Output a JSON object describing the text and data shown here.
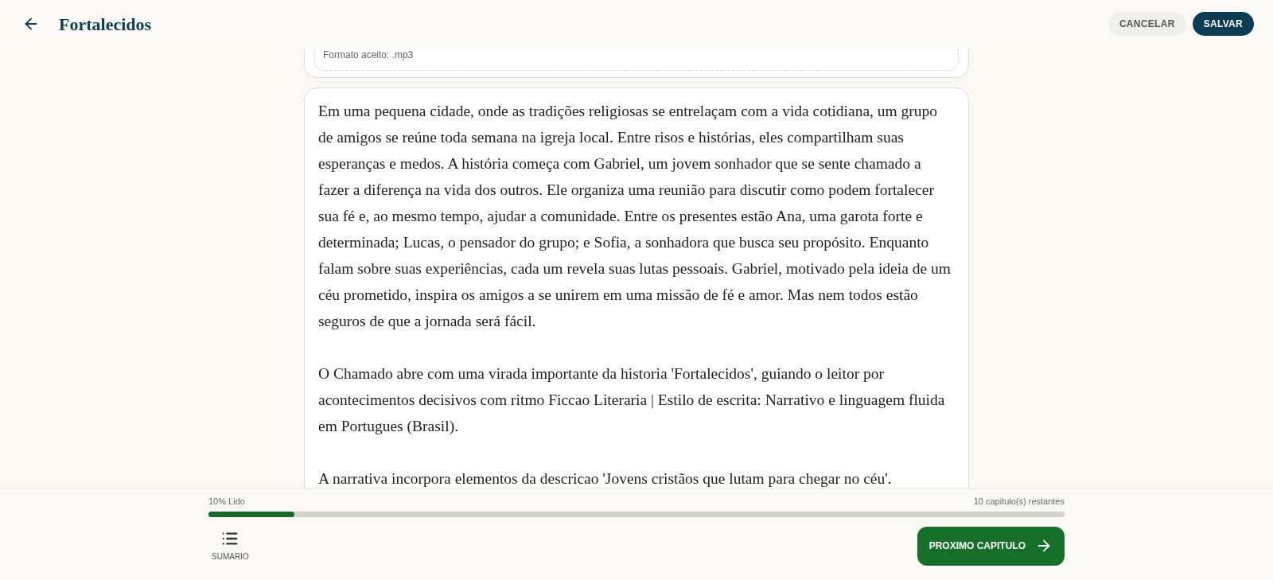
{
  "header": {
    "title": "Fortalecidos",
    "buttons": [
      {
        "label": "CANCELAR",
        "kind": "secondary"
      },
      {
        "label": "SALVAR",
        "kind": "primary"
      }
    ]
  },
  "audio_upload": {
    "hint": "Formato aceito: .mp3"
  },
  "chapter_text": {
    "paragraphs": [
      "Em uma pequena cidade, onde as tradições religiosas se entrelaçam com a vida cotidiana, um grupo de amigos se reúne toda semana na igreja local. Entre risos e histórias, eles compartilham suas esperanças e medos. A história começa com Gabriel, um jovem sonhador que se sente chamado a fazer a diferença na vida dos outros. Ele organiza uma reunião para discutir como podem fortalecer sua fé e, ao mesmo tempo, ajudar a comunidade. Entre os presentes estão Ana, uma garota forte e determinada; Lucas, o pensador do grupo; e Sofia, a sonhadora que busca seu propósito. Enquanto falam sobre suas experiências, cada um revela suas lutas pessoais. Gabriel, motivado pela ideia de um céu prometido, inspira os amigos a se unirem em uma missão de fé e amor. Mas nem todos estão seguros de que a jornada será fácil.",
      "O Chamado abre com uma virada importante da historia 'Fortalecidos', guiando o leitor por acontecimentos decisivos com ritmo Ficcao Literaria | Estilo de escrita: Narrativo e linguagem fluida em Portugues (Brasil).",
      "A narrativa incorpora elementos da descricao 'Jovens cristãos que lutam para chegar no céu'."
    ]
  },
  "footer": {
    "progress_label": "10% Lido",
    "remaining": "10 capitulo(s) restantes",
    "level": 0.1,
    "summary_label": "SUMARIO",
    "next_button": "PROXIMO CAPITULO"
  }
}
